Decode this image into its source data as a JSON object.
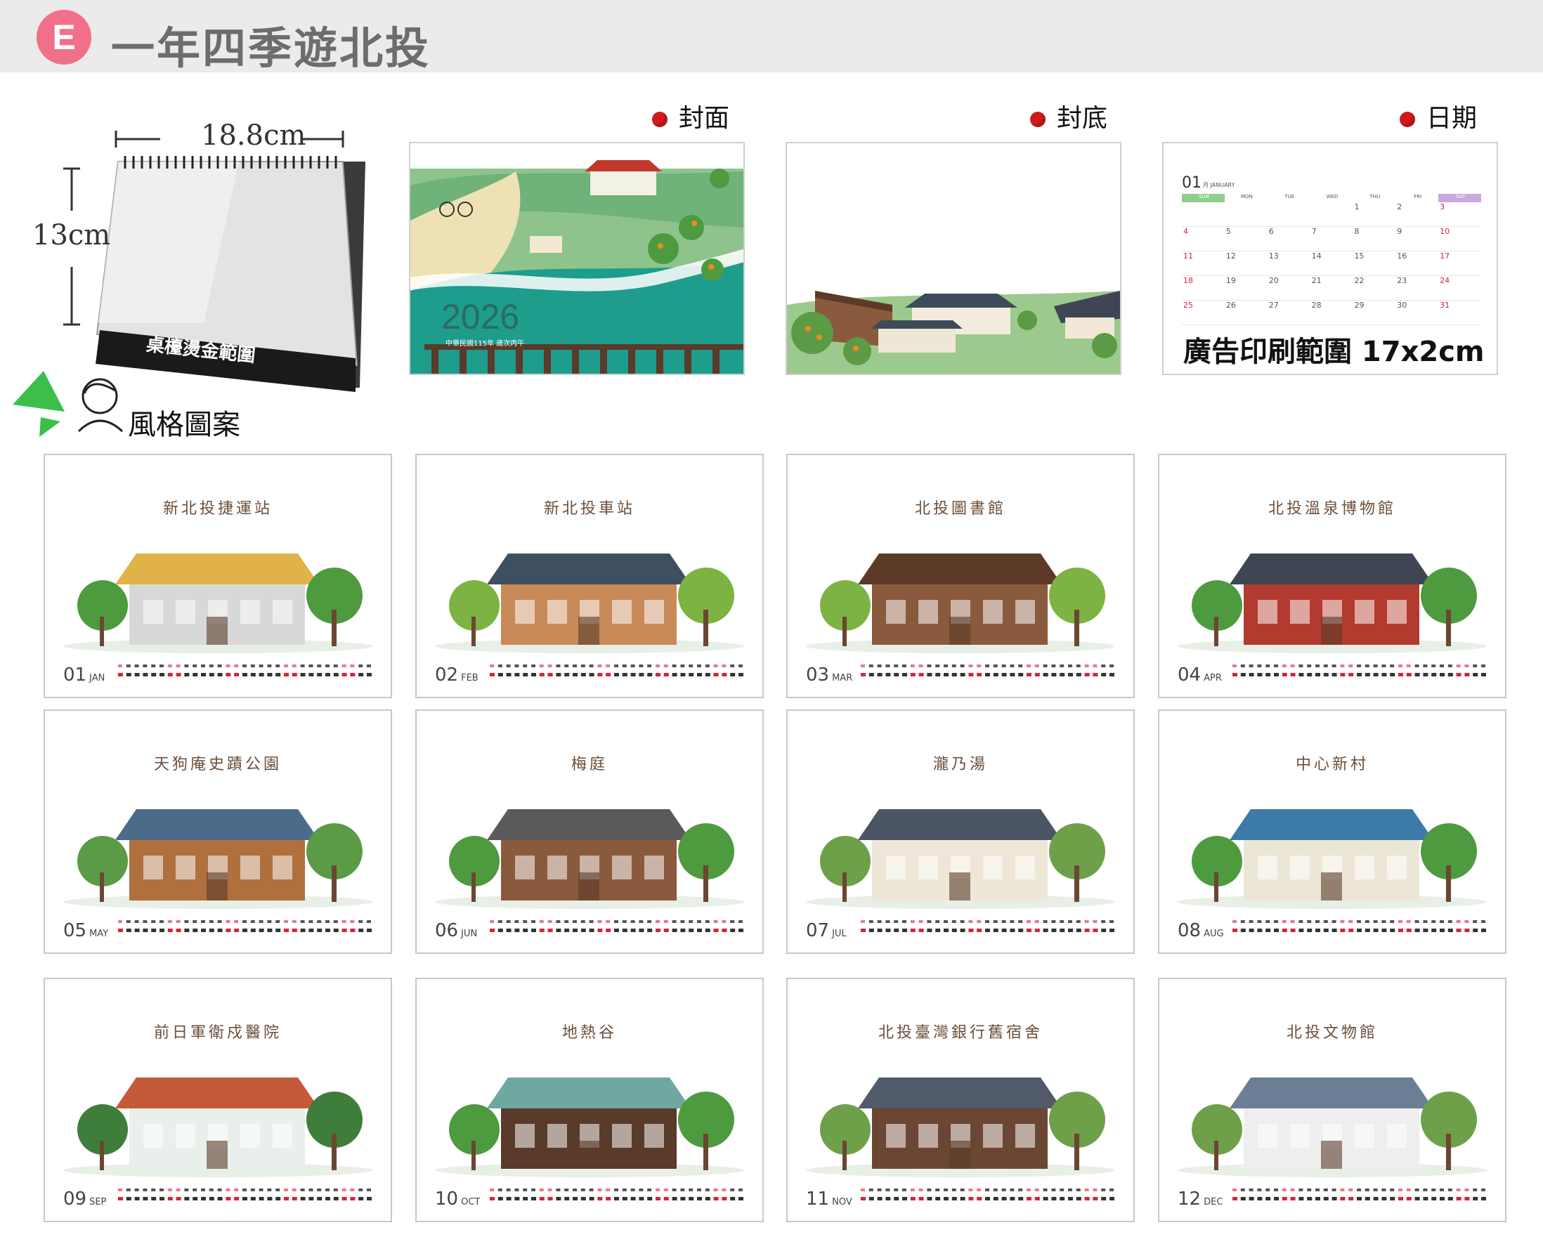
{
  "header": {
    "badge": "E",
    "title": "一年四季遊北投"
  },
  "desk_calendar": {
    "width_label": "18.8cm",
    "height_label": "13cm",
    "base_label": "桌檯燙金範圍"
  },
  "style_label": "風格圖案",
  "previews": {
    "cover": {
      "label": "封面",
      "year": "2026",
      "subtitle": "中華民國115年 歲次丙午"
    },
    "back": {
      "label": "封底"
    },
    "dates": {
      "label": "日期",
      "month_num": "01",
      "month_name": "月 JANUARY",
      "weekdays": [
        "SUN",
        "MON",
        "TUE",
        "WED",
        "THU",
        "FRI",
        "SAT"
      ],
      "weeks": [
        [
          "",
          "",
          "",
          "",
          "1",
          "2",
          "3"
        ],
        [
          "4",
          "5",
          "6",
          "7",
          "8",
          "9",
          "10"
        ],
        [
          "11",
          "12",
          "13",
          "14",
          "15",
          "16",
          "17"
        ],
        [
          "18",
          "19",
          "20",
          "21",
          "22",
          "23",
          "24"
        ],
        [
          "25",
          "26",
          "27",
          "28",
          "29",
          "30",
          "31"
        ]
      ],
      "ad_text": "廣告印刷範圍 17x2cm"
    }
  },
  "months": [
    {
      "num": "01",
      "abbr": "JAN",
      "title": "新北投捷運站"
    },
    {
      "num": "02",
      "abbr": "FEB",
      "title": "新北投車站"
    },
    {
      "num": "03",
      "abbr": "MAR",
      "title": "北投圖書館"
    },
    {
      "num": "04",
      "abbr": "APR",
      "title": "北投溫泉博物館"
    },
    {
      "num": "05",
      "abbr": "MAY",
      "title": "天狗庵史蹟公園"
    },
    {
      "num": "06",
      "abbr": "JUN",
      "title": "梅庭"
    },
    {
      "num": "07",
      "abbr": "JUL",
      "title": "瀧乃湯"
    },
    {
      "num": "08",
      "abbr": "AUG",
      "title": "中心新村"
    },
    {
      "num": "09",
      "abbr": "SEP",
      "title": "前日軍衛戍醫院"
    },
    {
      "num": "10",
      "abbr": "OCT",
      "title": "地熱谷"
    },
    {
      "num": "11",
      "abbr": "NOV",
      "title": "北投臺灣銀行舊宿舍"
    },
    {
      "num": "12",
      "abbr": "DEC",
      "title": "北投文物館"
    }
  ],
  "colors": {
    "accent_pink": "#f0708a",
    "red_dot": "#d11a1a",
    "header_bg": "#ebebeb",
    "weekend_red": "#d6243a"
  }
}
